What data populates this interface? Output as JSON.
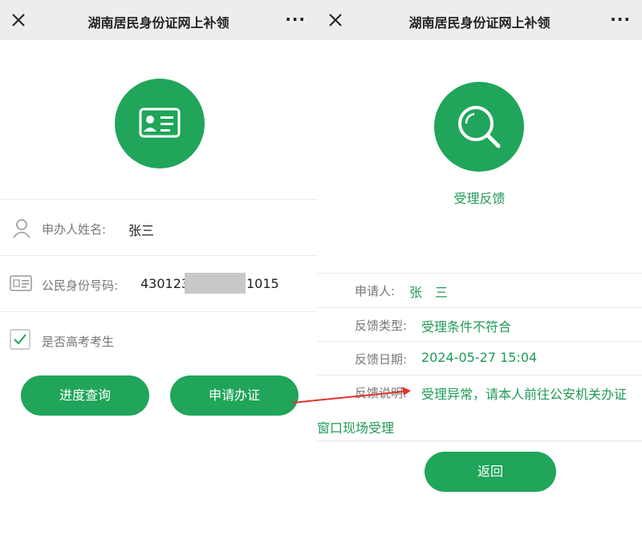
{
  "app": {
    "title": "湖南居民身份证网上补领",
    "more": "···"
  },
  "left": {
    "form": {
      "name_label": "申办人姓名:",
      "name_value": "张三",
      "id_label": "公民身份号码:",
      "id_prefix": "430123",
      "id_suffix": "1015",
      "gaokao_label": "是否高考考生",
      "gaokao_checked": true
    },
    "buttons": {
      "progress": "进度查询",
      "apply": "申请办证"
    }
  },
  "right": {
    "feedback_title": "受理反馈",
    "rows": {
      "applicant_label": "申请人:",
      "applicant_value": "张　三",
      "type_label": "反馈类型:",
      "type_value": "受理条件不符合",
      "date_label": "反馈日期:",
      "date_value": "2024-05-27 15:04",
      "desc_label": "反馈说明:",
      "desc_value_line1": "受理异常，请本人前往公安机关办证",
      "desc_value_line2": "窗口现场受理"
    },
    "back_button": "返回"
  },
  "colors": {
    "brand_green": "#20a55a",
    "text_green": "#1f9a56",
    "titlebar_bg": "#ededed",
    "annotation_arrow": "#e0352b"
  },
  "icons": {
    "close": "close-icon",
    "id_card": "id-card-icon",
    "search": "search-icon",
    "user": "user-icon",
    "id": "id-icon",
    "checkbox": "checkbox-icon"
  }
}
